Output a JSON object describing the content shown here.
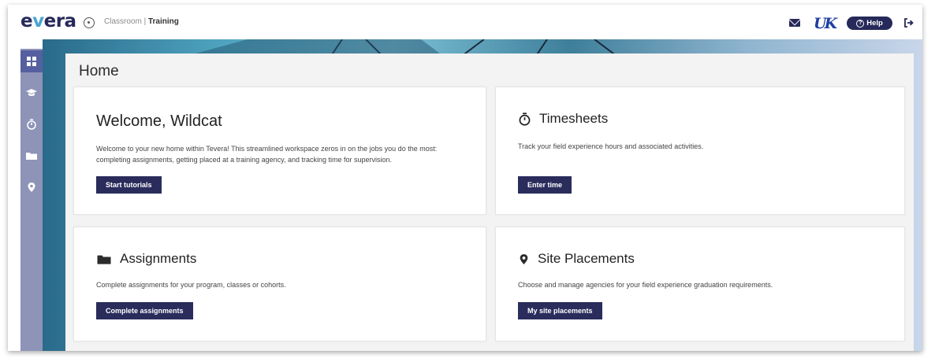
{
  "app": {
    "logo_prefix": "e",
    "logo_v": "v",
    "logo_suffix": "era",
    "breadcrumb": {
      "parent": "Classroom",
      "separator": "|",
      "current": "Training"
    }
  },
  "header": {
    "help_label": "Help",
    "help_glyph": "?"
  },
  "sidebar": {
    "items": [
      {
        "icon": "dashboard-icon",
        "active": true
      },
      {
        "icon": "graduation-cap-icon",
        "active": false
      },
      {
        "icon": "stopwatch-icon",
        "active": false
      },
      {
        "icon": "folder-icon",
        "active": false
      },
      {
        "icon": "map-pin-icon",
        "active": false
      }
    ]
  },
  "page": {
    "title": "Home"
  },
  "cards": {
    "welcome": {
      "title": "Welcome, Wildcat",
      "text_line1": "Welcome to your new home within Tevera! This streamlined workspace zeros in on the jobs you do the most:",
      "text_line2": "completing assignments, getting placed at a training agency, and tracking time for supervision.",
      "button": "Start tutorials"
    },
    "timesheets": {
      "icon": "stopwatch-icon",
      "title": "Timesheets",
      "text": "Track your field experience hours and associated activities.",
      "button": "Enter time"
    },
    "assignments": {
      "icon": "folder-icon",
      "title": "Assignments",
      "text": "Complete assignments for your program, classes or cohorts.",
      "button": "Complete assignments"
    },
    "site_placements": {
      "icon": "map-pin-icon",
      "title": "Site Placements",
      "text": "Choose and manage agencies for your field experience graduation requirements.",
      "button": "My site placements"
    }
  },
  "colors": {
    "brand_navy": "#26295a",
    "brand_light_blue": "#4aa3d4",
    "sidebar": "#8d94b8",
    "button": "#2a2c5c"
  }
}
